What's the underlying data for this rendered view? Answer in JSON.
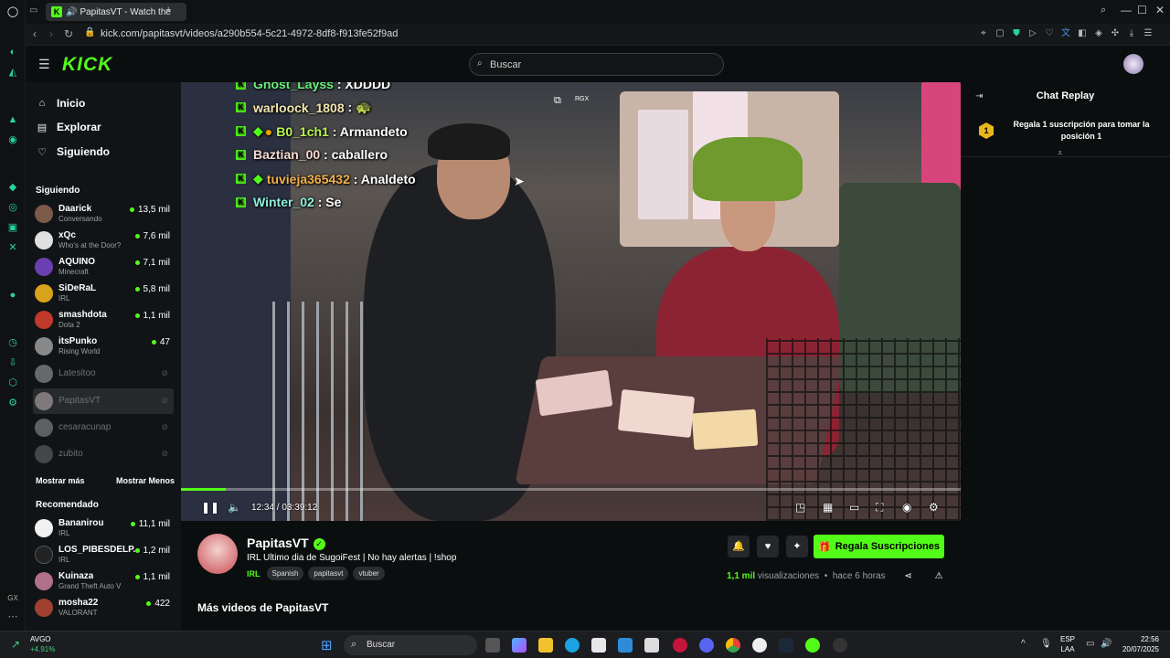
{
  "browser": {
    "tab_title": "PapitasVT - Watch the",
    "url": "kick.com/papitasvt/videos/a290b554-5c21-4972-8df8-f913fe52f9ad"
  },
  "header": {
    "logo": "KICK",
    "search_placeholder": "Buscar"
  },
  "sidebar": {
    "nav": [
      {
        "label": "Inicio",
        "icon": "home-icon"
      },
      {
        "label": "Explorar",
        "icon": "compass-icon"
      },
      {
        "label": "Siguiendo",
        "icon": "heart-icon"
      }
    ],
    "following_title": "Siguiendo",
    "following": [
      {
        "name": "Daarick",
        "sub": "Conversando",
        "viewers": "13,5 mil",
        "color": "#7b5a4a"
      },
      {
        "name": "xQc",
        "sub": "Who's at the Door?",
        "viewers": "7,6 mil",
        "color": "#e0e0e0"
      },
      {
        "name": "AQUINO",
        "sub": "Minecraft",
        "viewers": "7,1 mil",
        "color": "#6a3fb0"
      },
      {
        "name": "SiDeRaL",
        "sub": "IRL",
        "viewers": "5,8 mil",
        "color": "#d9a21c"
      },
      {
        "name": "smashdota",
        "sub": "Dota 2",
        "viewers": "1,1 mil",
        "color": "#c0392b"
      },
      {
        "name": "itsPunko",
        "sub": "Rising World",
        "viewers": "47",
        "color": "#888888"
      }
    ],
    "offline": [
      {
        "name": "Latesitoo",
        "color": "#bbbbbb"
      },
      {
        "name": "PapitasVT",
        "color": "#d8c8cc"
      },
      {
        "name": "cesaracunap",
        "color": "#aaaaaa"
      },
      {
        "name": "zubito",
        "color": "#777777"
      }
    ],
    "show_more": "Mostrar más",
    "show_less": "Mostrar Menos",
    "recommended_title": "Recomendado",
    "recommended": [
      {
        "name": "Bananirou",
        "sub": "IRL",
        "viewers": "11,1 mil",
        "color": "#f2f2f2"
      },
      {
        "name": "LOS_PIBESDELP...",
        "sub": "IRL",
        "viewers": "1,2 mil",
        "color": "#222222"
      },
      {
        "name": "Kuinaza",
        "sub": "Grand Theft Auto V",
        "viewers": "1,1 mil",
        "color": "#b0708a"
      },
      {
        "name": "mosha22",
        "sub": "VALORANT",
        "viewers": "422",
        "color": "#a04030"
      }
    ]
  },
  "video": {
    "overlay_chat": [
      {
        "user": "Ghost_Layss",
        "msg": ": XDDDD"
      },
      {
        "user": "warloock_1808",
        "msg": ": 🐢"
      },
      {
        "user": "B0_1ch1",
        "msg": ": Armandeto"
      },
      {
        "user": "Baztian_00",
        "msg": ": caballero"
      },
      {
        "user": "tuvieja365432",
        "msg": ": Analdeto"
      },
      {
        "user": "Winter_02",
        "msg": ": Se"
      }
    ],
    "time_current": "12:34",
    "time_total": "03:39:12",
    "progress": 0.057,
    "corner_label": "RGX"
  },
  "info": {
    "channel": "PapitasVT",
    "title": "IRL Ultimo dia de SugoiFest  | No hay alertas | !shop",
    "category": "IRL",
    "tags": [
      "Spanish",
      "papitasvt",
      "vtuber"
    ],
    "subscribe_label": "Regala Suscripciones",
    "views": "1,1 mil",
    "views_label": "visualizaciones",
    "ago": "hace 6 horas",
    "more_videos": "Más videos de PapitasVT"
  },
  "chat": {
    "title": "Chat Replay",
    "pinned_rank": "1",
    "pinned_text": "Regala 1 suscripción para tomar la posición 1"
  },
  "taskbar": {
    "weather_name": "AVGO",
    "weather_change": "+4.91%",
    "search": "Buscar",
    "lang1": "ESP",
    "lang2": "LAA",
    "time": "22:56",
    "date": "20/07/2025"
  },
  "colors": {
    "accent": "#53fc18",
    "background": "#0b0e0f"
  }
}
